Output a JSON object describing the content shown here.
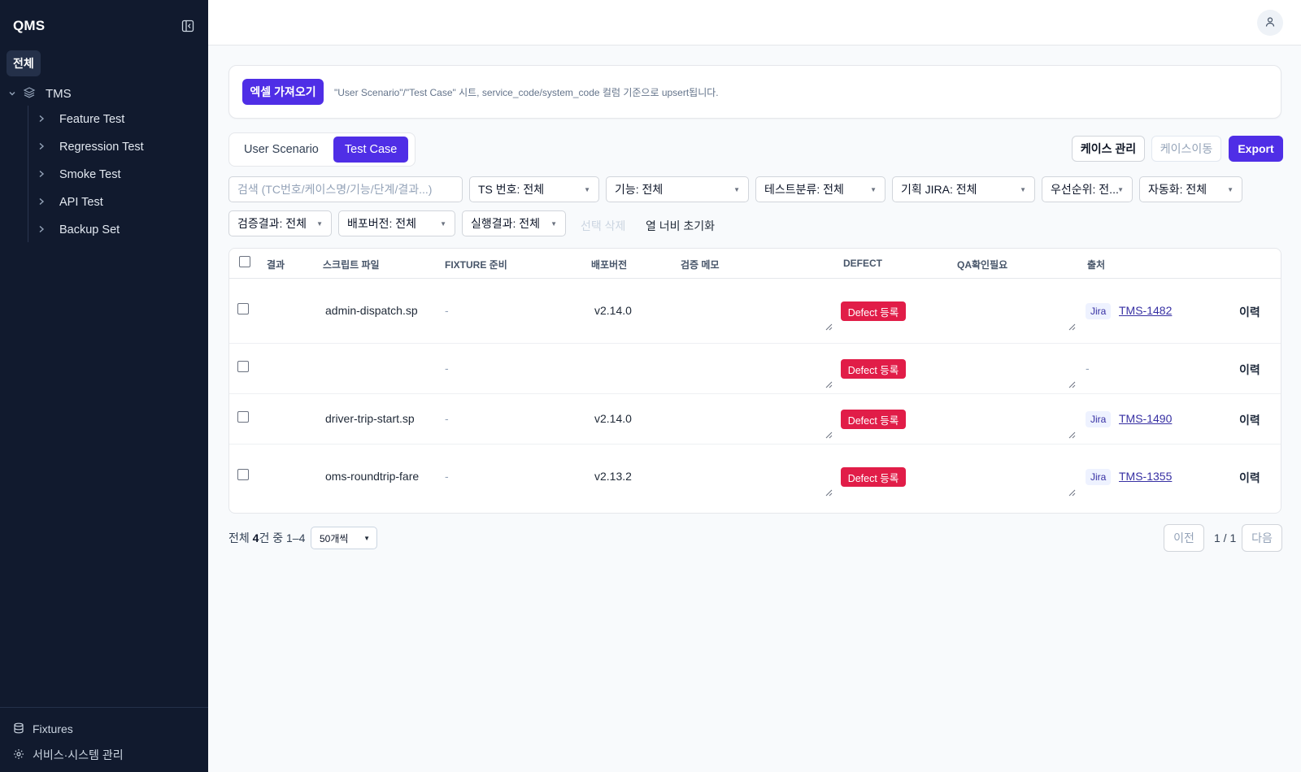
{
  "sidebar": {
    "brand": "QMS",
    "all_label": "전체",
    "tree_root": "TMS",
    "items": [
      {
        "label": "Feature Test"
      },
      {
        "label": "Regression Test"
      },
      {
        "label": "Smoke Test"
      },
      {
        "label": "API Test"
      },
      {
        "label": "Backup Set"
      }
    ],
    "bottom": [
      {
        "label": "Fixtures"
      },
      {
        "label": "서비스·시스템 관리"
      }
    ]
  },
  "import": {
    "button": "엑셀 가져오기",
    "description": "\"User Scenario\"/\"Test Case\" 시트, service_code/system_code 컬럼 기준으로 upsert됩니다."
  },
  "tabs": [
    {
      "label": "User Scenario",
      "active": false
    },
    {
      "label": "Test Case",
      "active": true
    }
  ],
  "actions": {
    "manage_cases": "케이스 관리",
    "move_cases": "케이스이동",
    "export": "Export"
  },
  "filters": {
    "search_placeholder": "검색 (TC번호/케이스명/기능/단계/결과...)",
    "ts_number": "TS 번호: 전체",
    "feature": "기능: 전체",
    "test_class": "테스트분류: 전체",
    "plan_jira": "기획 JIRA: 전체",
    "priority": "우선순위: 전...",
    "automation": "자동화: 전체",
    "verify_result": "검증결과: 전체",
    "deploy_version": "배포버전: 전체",
    "run_result": "실행결과: 전체",
    "delete_selected": "선택 삭제",
    "reset_widths": "열 너비 초기화"
  },
  "table": {
    "headers": {
      "result": "결과",
      "script": "스크립트 파일",
      "fixture": "FIXTURE 준비",
      "version": "배포버전",
      "memo": "검증 메모",
      "defect": "DEFECT",
      "qa_check": "QA확인필요",
      "source": "출처"
    },
    "rows": [
      {
        "script": "admin-dispatch.sp",
        "fixture": "-",
        "version": "v2.14.0",
        "defect": "Defect 등록",
        "source_tag": "Jira",
        "source_key": "TMS-1482",
        "source_empty": "",
        "history": "이력"
      },
      {
        "script": "",
        "fixture": "-",
        "version": "",
        "defect": "Defect 등록",
        "source_tag": "",
        "source_key": "",
        "source_empty": "-",
        "history": "이력"
      },
      {
        "script": "driver-trip-start.sp",
        "fixture": "-",
        "version": "v2.14.0",
        "defect": "Defect 등록",
        "source_tag": "Jira",
        "source_key": "TMS-1490",
        "source_empty": "",
        "history": "이력"
      },
      {
        "script": "oms-roundtrip-fare",
        "fixture": "-",
        "version": "v2.13.2",
        "defect": "Defect 등록",
        "source_tag": "Jira",
        "source_key": "TMS-1355",
        "source_empty": "",
        "history": "이력"
      }
    ]
  },
  "pagination": {
    "total_prefix": "전체 ",
    "total_count": "4",
    "total_suffix": "건 중 1–4",
    "per_page": "50개씩",
    "prev": "이전",
    "page_info": "1 / 1",
    "next": "다음"
  }
}
